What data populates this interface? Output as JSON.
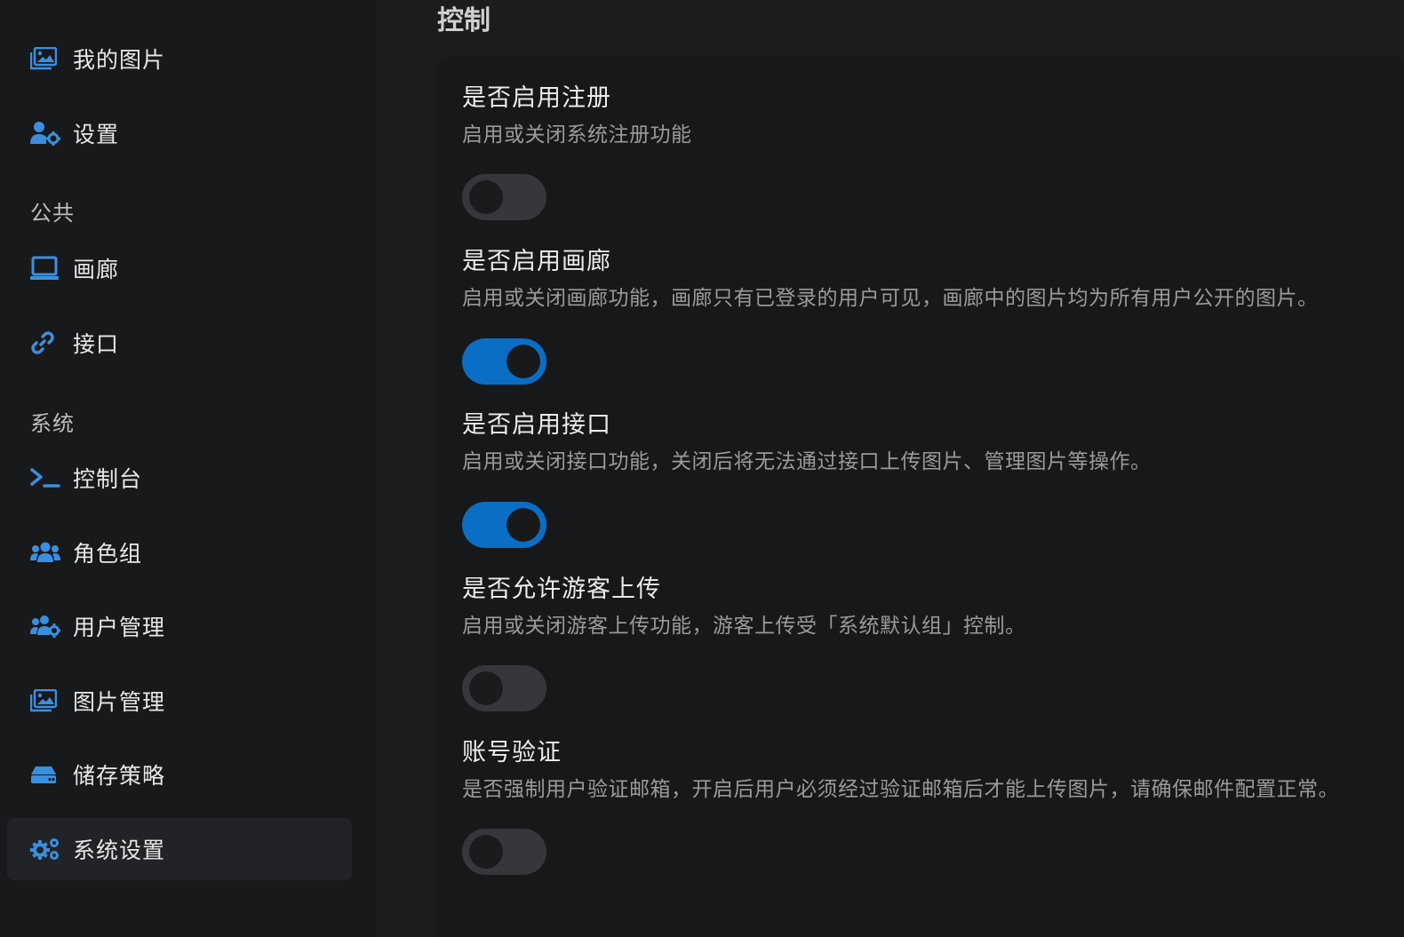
{
  "colors": {
    "accent": "#0a6ec4",
    "icon": "#3b8fe0",
    "background": "#1b1c1e",
    "sidebar": "#18191b",
    "card": "#17181a"
  },
  "sidebar": {
    "top_items": [
      {
        "label": "我的图片",
        "icon": "images-icon"
      },
      {
        "label": "设置",
        "icon": "user-gear-icon"
      }
    ],
    "public_section": {
      "title": "公共",
      "items": [
        {
          "label": "画廊",
          "icon": "monitor-icon"
        },
        {
          "label": "接口",
          "icon": "link-icon"
        }
      ]
    },
    "system_section": {
      "title": "系统",
      "items": [
        {
          "label": "控制台",
          "icon": "terminal-icon"
        },
        {
          "label": "角色组",
          "icon": "users-icon"
        },
        {
          "label": "用户管理",
          "icon": "users-gear-icon"
        },
        {
          "label": "图片管理",
          "icon": "images-icon"
        },
        {
          "label": "储存策略",
          "icon": "hard-drive-icon"
        },
        {
          "label": "系统设置",
          "icon": "gears-icon",
          "active": true
        }
      ]
    }
  },
  "main": {
    "title": "控制",
    "settings": [
      {
        "title": "是否启用注册",
        "desc": "启用或关闭系统注册功能",
        "enabled": false
      },
      {
        "title": "是否启用画廊",
        "desc": "启用或关闭画廊功能，画廊只有已登录的用户可见，画廊中的图片均为所有用户公开的图片。",
        "enabled": true
      },
      {
        "title": "是否启用接口",
        "desc": "启用或关闭接口功能，关闭后将无法通过接口上传图片、管理图片等操作。",
        "enabled": true
      },
      {
        "title": "是否允许游客上传",
        "desc": "启用或关闭游客上传功能，游客上传受「系统默认组」控制。",
        "enabled": false
      },
      {
        "title": "账号验证",
        "desc": "是否强制用户验证邮箱，开启后用户必须经过验证邮箱后才能上传图片，请确保邮件配置正常。",
        "enabled": false
      }
    ]
  }
}
